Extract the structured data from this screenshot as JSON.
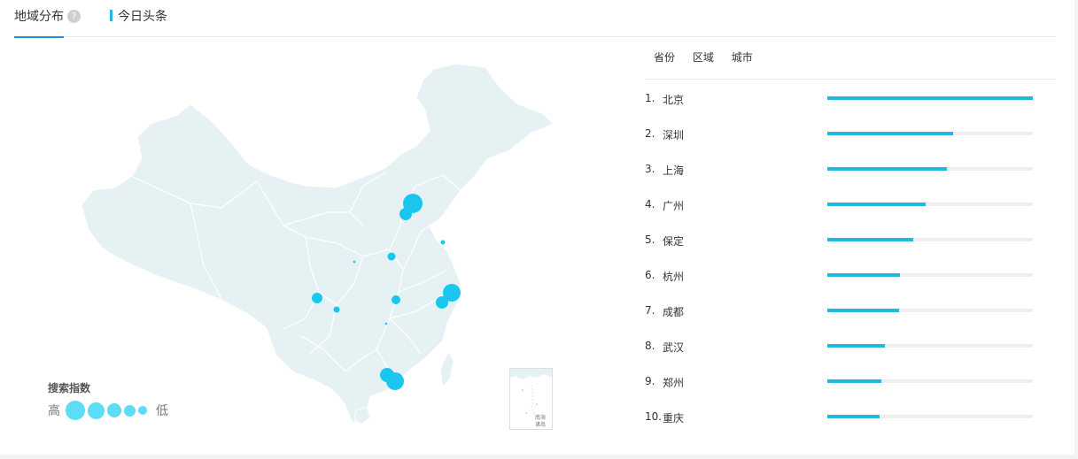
{
  "tabs": {
    "main_label": "地域分布",
    "help": "?",
    "source_label": "今日头条"
  },
  "legend": {
    "title": "搜索指数",
    "high": "高",
    "low": "低"
  },
  "inset": {
    "label": "南海诸岛"
  },
  "rank": {
    "tabs": [
      "省份",
      "区域",
      "城市"
    ],
    "items": [
      {
        "rank": "1.",
        "city": "北京",
        "value": 1.0
      },
      {
        "rank": "2.",
        "city": "深圳",
        "value": 0.61
      },
      {
        "rank": "3.",
        "city": "上海",
        "value": 0.58
      },
      {
        "rank": "4.",
        "city": "广州",
        "value": 0.48
      },
      {
        "rank": "5.",
        "city": "保定",
        "value": 0.42
      },
      {
        "rank": "6.",
        "city": "杭州",
        "value": 0.355
      },
      {
        "rank": "7.",
        "city": "成都",
        "value": 0.35
      },
      {
        "rank": "8.",
        "city": "武汉",
        "value": 0.28
      },
      {
        "rank": "9.",
        "city": "郑州",
        "value": 0.265
      },
      {
        "rank": "10.",
        "city": "重庆",
        "value": 0.255
      }
    ]
  },
  "colors": {
    "accent": "#1fb7e6",
    "tab_underline": "#2a8bd8",
    "map_fill": "#e6f1f4",
    "bubble": "#19c6f0"
  }
}
